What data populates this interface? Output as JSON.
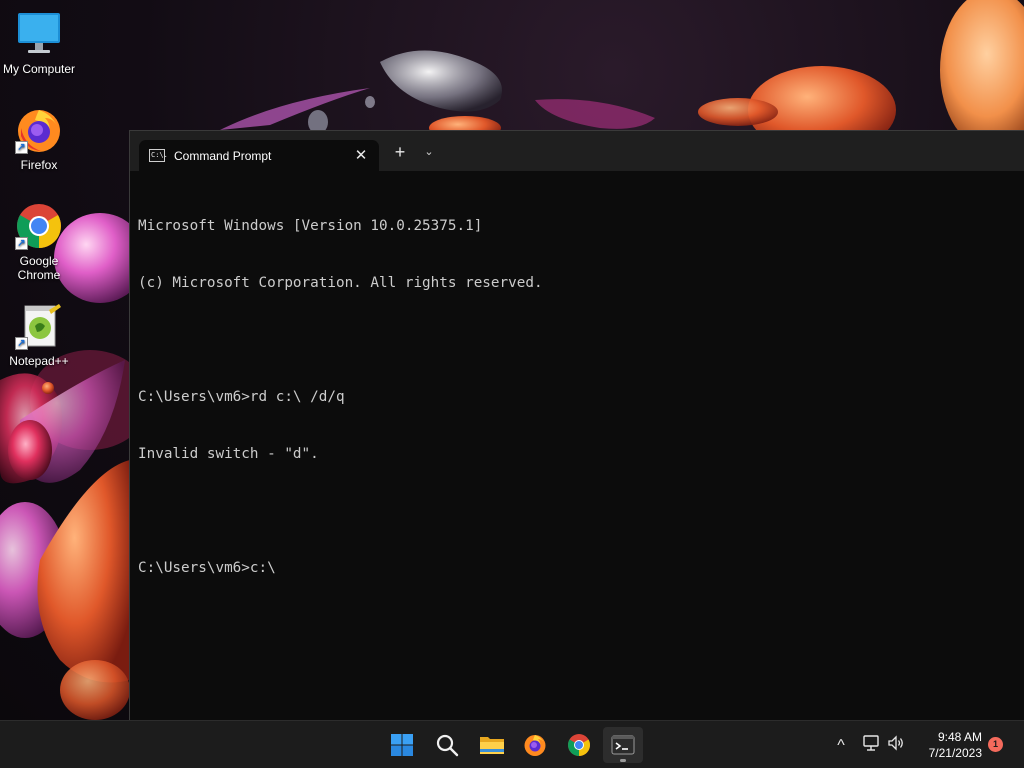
{
  "desktop": {
    "icons": [
      {
        "label": "My Computer",
        "icon": "monitor-icon"
      },
      {
        "label": "Firefox",
        "icon": "firefox-icon"
      },
      {
        "label": "Google Chrome",
        "icon": "chrome-icon"
      },
      {
        "label": "Notepad++",
        "icon": "notepadpp-icon"
      }
    ]
  },
  "terminal": {
    "tab_title": "Command Prompt",
    "tab_icon_text": "C:\\.",
    "close_glyph": "✕",
    "new_tab_glyph": "+",
    "dropdown_glyph": "⌄",
    "lines": [
      "Microsoft Windows [Version 10.0.25375.1]",
      "(c) Microsoft Corporation. All rights reserved.",
      "",
      "C:\\Users\\vm6>rd c:\\ /d/q",
      "Invalid switch - \"d\".",
      "",
      "C:\\Users\\vm6>c:\\"
    ]
  },
  "taskbar": {
    "apps": [
      {
        "name": "start",
        "icon": "windows-start-icon"
      },
      {
        "name": "search",
        "icon": "search-icon"
      },
      {
        "name": "file-explorer",
        "icon": "folder-icon"
      },
      {
        "name": "firefox",
        "icon": "firefox-icon"
      },
      {
        "name": "chrome",
        "icon": "chrome-icon"
      },
      {
        "name": "terminal",
        "icon": "terminal-icon",
        "active": true
      }
    ],
    "tray": {
      "chevron_glyph": "^",
      "time": "9:48 AM",
      "date": "7/21/2023",
      "notification_count": "1"
    }
  },
  "colors": {
    "terminal_bg": "#0c0c0c",
    "titlebar_bg": "#1f1f1f",
    "console_text": "#cccccc",
    "taskbar_bg": "#1c1c1c",
    "notification_badge": "#f46a5c"
  }
}
